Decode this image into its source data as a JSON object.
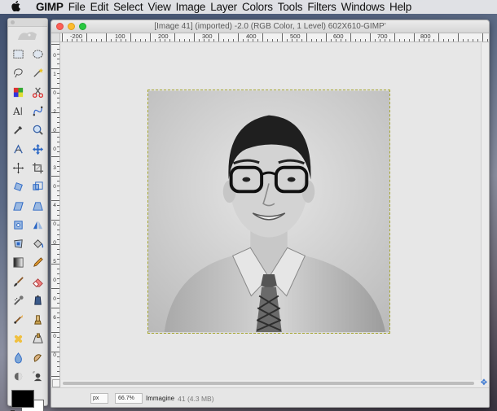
{
  "menubar": {
    "apple": "",
    "app_name": "GIMP",
    "items": [
      "File",
      "Edit",
      "Select",
      "View",
      "Image",
      "Layer",
      "Colors",
      "Tools",
      "Filters",
      "Windows",
      "Help"
    ]
  },
  "toolbox": {
    "tools": [
      "rect-select-icon",
      "ellipse-select-icon",
      "free-select-icon",
      "fuzzy-select-icon",
      "color-select-icon",
      "scissors-select-icon",
      "text-icon",
      "paths-icon",
      "color-picker-icon",
      "zoom-icon",
      "measure-icon",
      "move-icon",
      "align-icon",
      "crop-icon",
      "rotate-icon",
      "scale-icon",
      "shear-icon",
      "perspective-icon",
      "unified-transform-icon",
      "flip-icon",
      "cage-transform-icon",
      "bucket-fill-icon",
      "gradient-icon",
      "pencil-icon",
      "paintbrush-icon",
      "eraser-icon",
      "airbrush-icon",
      "ink-icon",
      "mypaint-brush-icon",
      "clone-icon",
      "heal-icon",
      "perspective-clone-icon",
      "blur-icon",
      "smudge-icon",
      "dodge-burn-icon",
      "fg-select-icon"
    ],
    "fg_color": "#000000",
    "bg_color": "#ffffff"
  },
  "window": {
    "title": "[Image 41] (imported) -2.0 (RGB Color, 1 Level) 602X610-GIMP'",
    "ruler_h_labels": [
      "-200",
      "100",
      "200",
      "300",
      "400",
      "500",
      "600",
      "700",
      "800"
    ],
    "ruler_v_labels": [
      "0",
      "1",
      "0",
      "2",
      "0",
      "0",
      "3",
      "0",
      "4",
      "0",
      "0",
      "5",
      "0",
      "0",
      "6",
      "0",
      "0"
    ]
  },
  "statusbar": {
    "unit": "px",
    "zoom": "66.7%",
    "label": "Immagine",
    "info": "41 (4.3 MB)"
  },
  "colors": {
    "menubar_bg": "#ebebee",
    "selection_border": "#a6a630"
  }
}
